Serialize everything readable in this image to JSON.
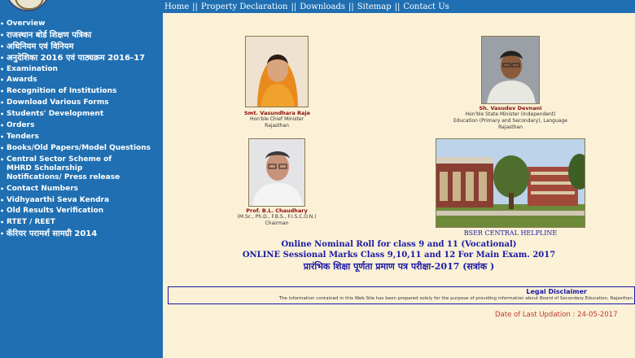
{
  "topnav": {
    "items": [
      "Home",
      "Property Declaration",
      "Downloads",
      "Sitemap",
      "Contact Us"
    ]
  },
  "sidebar": {
    "items": [
      "Overview",
      "राजस्थान बोर्ड शिक्षण पत्रिका",
      "अधिनियम एवं विनियम",
      "अनुदेशिका 2016 एवं पाठ्यक्रम 2016-17",
      "Examination",
      "Awards",
      "Recognition of Institutions",
      "Download Various Forms",
      "Students' Development",
      "Orders",
      "Tenders",
      "Books/Old Papers/Model Questions",
      "Central Sector Scheme of MHRD Scholarship Notifications/ Press release",
      "Contact Numbers",
      "Vidhyaarthi Seva Kendra",
      "Old Results Verification",
      "RTET / REET",
      "कॅरियर परामर्श सामग्री 2014"
    ]
  },
  "officials": [
    {
      "name": "Smt. Vasundhara Raje",
      "line1": "Hon'ble Chief Minister",
      "line2": "Rajasthan"
    },
    {
      "name": "Sh. Vasudev Devnani",
      "line1": "Hon'ble State Minister (Independent)",
      "line2": "Education (Primary and Secondary), Language",
      "line3": "Rajasthan"
    },
    {
      "name": "Prof. B.L. Chaudhary",
      "line1": "(M.Sc., Ph.D., F.B.S., F.I.S.C.O.N.)",
      "line2": "Chairman"
    }
  ],
  "helpline": "BSER CENTRAL HELPLINE",
  "links": [
    "Online Nominal Roll for class 9 and 11 (Vocational)",
    "ONLINE Sessional Marks Class 9,10,11 and 12 For Main Exam. 2017",
    "प्रारंभिक शिक्षा पूर्णता प्रमाण पत्र परीक्षा-2017 (सत्रांक )"
  ],
  "disclaimer": {
    "title": "Legal Disclaimer",
    "text": "The information contained in this Web Site has been prepared solely for the purpose of providing information about Board of Secondary Education, Rajasthan"
  },
  "last_update": "Date of Last Updation : 24-05-2017"
}
